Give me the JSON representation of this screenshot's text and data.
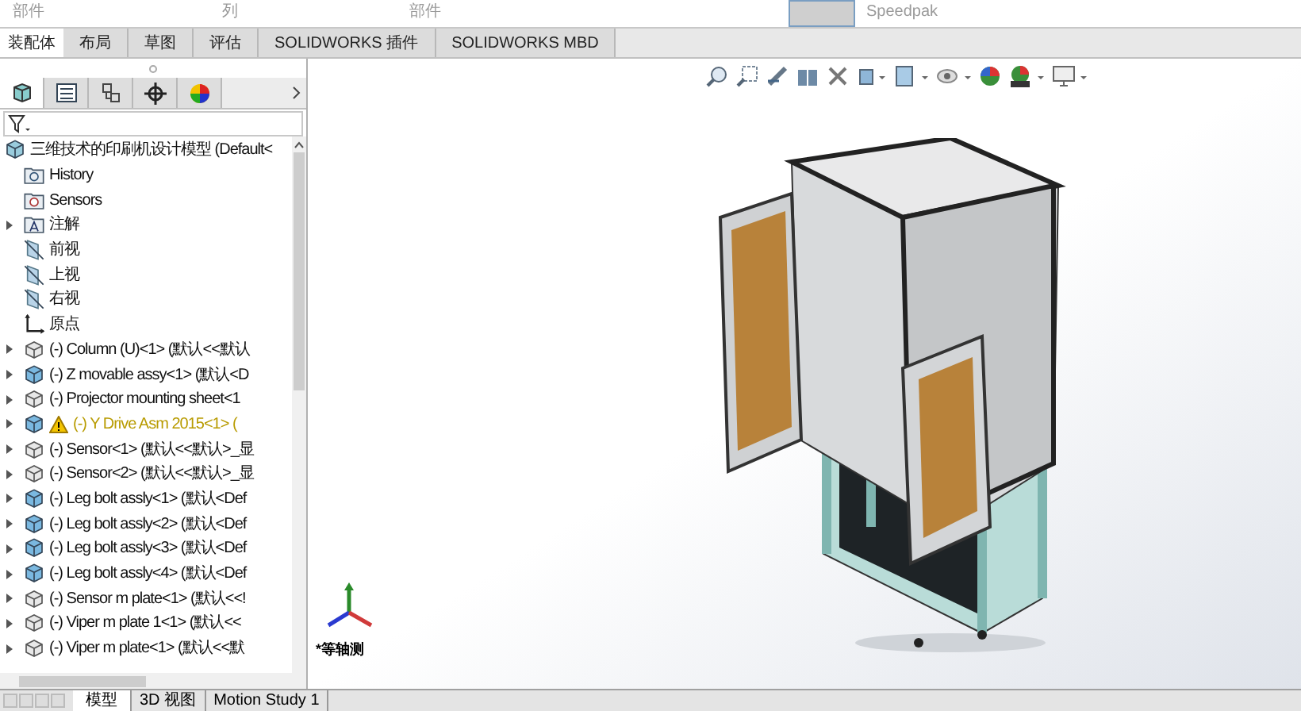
{
  "ribbon": {
    "labels": [
      "部件",
      "列",
      "部件",
      "Speedpak"
    ]
  },
  "command_tabs": [
    {
      "label": "装配体",
      "selected": true
    },
    {
      "label": "布局",
      "selected": false
    },
    {
      "label": "草图",
      "selected": false
    },
    {
      "label": "评估",
      "selected": false
    },
    {
      "label": "SOLIDWORKS 插件",
      "selected": false
    },
    {
      "label": "SOLIDWORKS MBD",
      "selected": false
    }
  ],
  "panel_tabs": [
    {
      "selected": true
    },
    {
      "selected": false
    },
    {
      "selected": false
    },
    {
      "selected": false
    },
    {
      "selected": false
    }
  ],
  "feature_tree": {
    "root": "三维技术的印刷机设计模型 (Default<",
    "items": [
      {
        "kind": "history",
        "label": "History",
        "expandable": false
      },
      {
        "kind": "sensors",
        "label": "Sensors",
        "expandable": false
      },
      {
        "kind": "annotations",
        "label": "注解",
        "expandable": true
      },
      {
        "kind": "plane",
        "label": "前视",
        "expandable": false
      },
      {
        "kind": "plane",
        "label": "上视",
        "expandable": false
      },
      {
        "kind": "plane",
        "label": "右视",
        "expandable": false
      },
      {
        "kind": "origin",
        "label": "原点",
        "expandable": false
      },
      {
        "kind": "part",
        "label": "(-) Column (U)<1> (默认<<默认",
        "expandable": true
      },
      {
        "kind": "assembly",
        "label": "(-) Z movable assy<1> (默认<D",
        "expandable": true
      },
      {
        "kind": "part",
        "label": "(-) Projector mounting sheet<1",
        "expandable": true
      },
      {
        "kind": "assembly",
        "label": "(-) Y Drive Asm 2015<1> (",
        "expandable": true,
        "warning": true
      },
      {
        "kind": "part",
        "label": "(-) Sensor<1> (默认<<默认>_显",
        "expandable": true
      },
      {
        "kind": "part",
        "label": "(-) Sensor<2> (默认<<默认>_显",
        "expandable": true
      },
      {
        "kind": "assembly",
        "label": "(-) Leg bolt assly<1> (默认<Def",
        "expandable": true
      },
      {
        "kind": "assembly",
        "label": "(-) Leg bolt assly<2> (默认<Def",
        "expandable": true
      },
      {
        "kind": "assembly",
        "label": "(-) Leg bolt assly<3> (默认<Def",
        "expandable": true
      },
      {
        "kind": "assembly",
        "label": "(-) Leg bolt assly<4> (默认<Def",
        "expandable": true
      },
      {
        "kind": "part",
        "label": "(-) Sensor m plate<1> (默认<<!",
        "expandable": true
      },
      {
        "kind": "part",
        "label": "(-) Viper m plate 1<1> (默认<<",
        "expandable": true
      },
      {
        "kind": "part",
        "label": "(-) Viper m plate<1> (默认<<默",
        "expandable": true
      }
    ]
  },
  "bottom_tabs": [
    {
      "label": "模型",
      "selected": true
    },
    {
      "label": "3D 视图",
      "selected": false
    },
    {
      "label": "Motion Study 1",
      "selected": false
    }
  ],
  "viewport": {
    "view_label": "*等轴测"
  }
}
